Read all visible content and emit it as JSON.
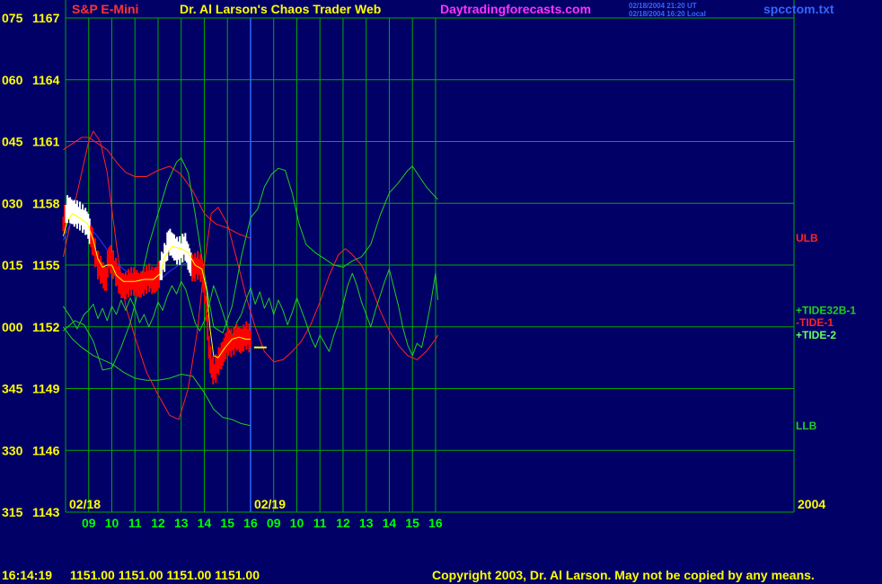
{
  "header": {
    "instrument": "S&P E-Mini",
    "author": "Dr. Al Larson's Chaos Trader Web",
    "site": "Daytradingforecasts.com",
    "stamp_line1": "02/18/2004 21:20 UT",
    "stamp_line2": "02/18/2004 16:20 Local",
    "filename": "spcctom.txt"
  },
  "footer": {
    "time": "16:14:19",
    "quote": "1151.00 1151.00 1151.00 1151.00",
    "copyright": "Copyright 2003, Dr. Al Larson. May not be copied by any means."
  },
  "colors": {
    "background": "#000066",
    "grid": "#00aa00",
    "axis_text": "#ffff00",
    "date_text": "#00ff00",
    "instrument": "#ff3333",
    "site": "#ff33ff",
    "stamp": "#3366ff",
    "filename": "#3366ff",
    "bars_red": "#ff0000",
    "bars_white": "#ffffff",
    "ma_yellow": "#ffff00",
    "ma_blue": "#3333ff",
    "tide_red": "#ff2222",
    "tide_green": "#22cc22",
    "tide_lightgreen": "#66ff66",
    "last_price": "#ffff00"
  },
  "chart_data": {
    "type": "line",
    "y_axis": {
      "ylim": [
        1143,
        1167
      ],
      "ticks": [
        {
          "code": "075",
          "price": "1167",
          "value": 1167
        },
        {
          "code": "060",
          "price": "1164",
          "value": 1164
        },
        {
          "code": "045",
          "price": "1161",
          "value": 1161
        },
        {
          "code": "030",
          "price": "1158",
          "value": 1158
        },
        {
          "code": "015",
          "price": "1155",
          "value": 1155
        },
        {
          "code": "000",
          "price": "1152",
          "value": 1152
        },
        {
          "code": "345",
          "price": "1149",
          "value": 1149
        },
        {
          "code": "330",
          "price": "1146",
          "value": 1146
        },
        {
          "code": "315",
          "price": "1143",
          "value": 1143
        }
      ]
    },
    "x_axis": {
      "xlim": [
        0,
        31.5
      ],
      "hour_ticks": [
        {
          "label": "09",
          "x": 1
        },
        {
          "label": "10",
          "x": 2
        },
        {
          "label": "11",
          "x": 3
        },
        {
          "label": "12",
          "x": 4
        },
        {
          "label": "13",
          "x": 5
        },
        {
          "label": "14",
          "x": 6
        },
        {
          "label": "15",
          "x": 7
        },
        {
          "label": "16",
          "x": 8
        },
        {
          "label": "09",
          "x": 9
        },
        {
          "label": "10",
          "x": 10
        },
        {
          "label": "11",
          "x": 11
        },
        {
          "label": "12",
          "x": 12
        },
        {
          "label": "13",
          "x": 13
        },
        {
          "label": "14",
          "x": 14
        },
        {
          "label": "15",
          "x": 15
        },
        {
          "label": "16",
          "x": 16
        }
      ],
      "date_markers": [
        {
          "label": "02/18",
          "x": 0
        },
        {
          "label": "02/19",
          "x": 8
        }
      ],
      "year_label": "2004",
      "day_divider_x": 8
    },
    "series_labels": [
      {
        "text": "ULB",
        "color": "#ff2222",
        "y": 1156.3
      },
      {
        "text": "+TIDE32B-1",
        "color": "#22cc22",
        "y": 1152.8
      },
      {
        "text": "-TIDE-1",
        "color": "#ff2222",
        "y": 1152.2
      },
      {
        "text": "+TIDE-2",
        "color": "#66ff66",
        "y": 1151.6
      },
      {
        "text": "LLB",
        "color": "#22cc22",
        "y": 1147.2
      }
    ],
    "price": [
      [
        -0.1,
        1157.0
      ],
      [
        0.1,
        1157.8
      ],
      [
        0.25,
        1157.6
      ],
      [
        0.4,
        1157.5
      ],
      [
        0.6,
        1157.4
      ],
      [
        0.8,
        1157.2
      ],
      [
        0.95,
        1157.0
      ],
      [
        1.2,
        1156.0
      ],
      [
        1.4,
        1155.0
      ],
      [
        1.6,
        1154.6
      ],
      [
        1.75,
        1154.2
      ],
      [
        1.85,
        1155.4
      ],
      [
        2.0,
        1155.2
      ],
      [
        2.2,
        1154.6
      ],
      [
        2.4,
        1154.0
      ],
      [
        2.6,
        1154.0
      ],
      [
        2.8,
        1154.2
      ],
      [
        3.0,
        1154.2
      ],
      [
        3.2,
        1154.0
      ],
      [
        3.4,
        1154.2
      ],
      [
        3.6,
        1154.4
      ],
      [
        3.8,
        1154.2
      ],
      [
        4.0,
        1154.4
      ],
      [
        4.2,
        1155.1
      ],
      [
        4.35,
        1155.6
      ],
      [
        4.45,
        1156.2
      ],
      [
        4.6,
        1156.0
      ],
      [
        4.8,
        1155.7
      ],
      [
        5.0,
        1155.7
      ],
      [
        5.15,
        1156.0
      ],
      [
        5.3,
        1155.4
      ],
      [
        5.5,
        1154.8
      ],
      [
        5.7,
        1155.0
      ],
      [
        5.9,
        1154.8
      ],
      [
        6.0,
        1154.0
      ],
      [
        6.1,
        1152.6
      ],
      [
        6.2,
        1151.0
      ],
      [
        6.3,
        1150.0
      ],
      [
        6.45,
        1149.8
      ],
      [
        6.6,
        1150.3
      ],
      [
        6.8,
        1150.7
      ],
      [
        7.0,
        1151.3
      ],
      [
        7.2,
        1151.2
      ],
      [
        7.4,
        1151.5
      ],
      [
        7.6,
        1151.3
      ],
      [
        7.8,
        1151.6
      ],
      [
        8.0,
        1151.4
      ]
    ],
    "white_bar_segments": [
      [
        0.0,
        1.1
      ],
      [
        4.05,
        5.45
      ]
    ],
    "last_price_marker": {
      "x": 8.15,
      "value": 1151.0
    },
    "ma_yellow": [
      [
        -0.1,
        1156.4
      ],
      [
        0.1,
        1157.2
      ],
      [
        0.3,
        1157.5
      ],
      [
        0.6,
        1157.3
      ],
      [
        0.95,
        1157.0
      ],
      [
        1.2,
        1156.2
      ],
      [
        1.4,
        1155.3
      ],
      [
        1.6,
        1154.9
      ],
      [
        1.8,
        1155.0
      ],
      [
        2.0,
        1155.0
      ],
      [
        2.2,
        1154.5
      ],
      [
        2.5,
        1154.2
      ],
      [
        3.0,
        1154.2
      ],
      [
        3.4,
        1154.3
      ],
      [
        3.8,
        1154.3
      ],
      [
        4.1,
        1154.6
      ],
      [
        4.3,
        1155.4
      ],
      [
        4.6,
        1155.9
      ],
      [
        5.0,
        1155.8
      ],
      [
        5.3,
        1155.6
      ],
      [
        5.6,
        1155.0
      ],
      [
        5.9,
        1154.8
      ],
      [
        6.1,
        1153.8
      ],
      [
        6.25,
        1151.9
      ],
      [
        6.4,
        1150.6
      ],
      [
        6.6,
        1150.5
      ],
      [
        6.9,
        1151.0
      ],
      [
        7.2,
        1151.4
      ],
      [
        7.5,
        1151.5
      ],
      [
        7.8,
        1151.4
      ],
      [
        8.0,
        1151.4
      ]
    ],
    "ma_blue": [
      [
        -0.1,
        1156.2
      ],
      [
        0.2,
        1157.0
      ],
      [
        0.5,
        1157.2
      ],
      [
        0.9,
        1156.9
      ],
      [
        1.3,
        1156.5
      ],
      [
        1.7,
        1155.9
      ],
      [
        2.1,
        1155.2
      ],
      [
        2.5,
        1154.8
      ],
      [
        2.9,
        1154.5
      ],
      [
        3.3,
        1154.3
      ],
      [
        3.7,
        1154.2
      ],
      [
        4.1,
        1154.3
      ],
      [
        4.5,
        1154.7
      ],
      [
        4.9,
        1155.0
      ],
      [
        5.3,
        1155.1
      ],
      [
        5.6,
        1155.0
      ],
      [
        5.9,
        1154.6
      ]
    ],
    "ulb": [
      [
        -0.1,
        1160.6
      ],
      [
        0.3,
        1160.9
      ],
      [
        0.7,
        1161.2
      ],
      [
        1.0,
        1161.2
      ],
      [
        1.4,
        1160.9
      ],
      [
        1.8,
        1160.6
      ],
      [
        2.2,
        1160.0
      ],
      [
        2.6,
        1159.5
      ],
      [
        3.0,
        1159.3
      ],
      [
        3.5,
        1159.3
      ],
      [
        4.0,
        1159.6
      ],
      [
        4.5,
        1159.8
      ],
      [
        5.0,
        1159.4
      ],
      [
        5.5,
        1158.6
      ],
      [
        6.0,
        1157.5
      ],
      [
        6.5,
        1157.0
      ],
      [
        7.0,
        1156.8
      ],
      [
        7.5,
        1156.5
      ],
      [
        8.0,
        1156.3
      ]
    ],
    "llb": [
      [
        -0.1,
        1152.0
      ],
      [
        0.3,
        1151.4
      ],
      [
        0.7,
        1151.0
      ],
      [
        1.2,
        1150.6
      ],
      [
        1.6,
        1150.4
      ],
      [
        2.0,
        1150.2
      ],
      [
        2.5,
        1149.8
      ],
      [
        3.0,
        1149.5
      ],
      [
        3.5,
        1149.4
      ],
      [
        4.0,
        1149.4
      ],
      [
        4.5,
        1149.5
      ],
      [
        5.0,
        1149.7
      ],
      [
        5.5,
        1149.6
      ],
      [
        6.0,
        1148.8
      ],
      [
        6.4,
        1148.0
      ],
      [
        6.8,
        1147.6
      ],
      [
        7.2,
        1147.5
      ],
      [
        7.6,
        1147.3
      ],
      [
        8.0,
        1147.2
      ]
    ],
    "tide_red": [
      [
        -0.1,
        1155.4
      ],
      [
        0.3,
        1157.5
      ],
      [
        0.7,
        1159.5
      ],
      [
        1.0,
        1161.0
      ],
      [
        1.2,
        1161.5
      ],
      [
        1.5,
        1161.0
      ],
      [
        1.8,
        1159.5
      ],
      [
        2.2,
        1156.0
      ],
      [
        2.6,
        1153.0
      ],
      [
        3.0,
        1151.5
      ],
      [
        3.5,
        1149.8
      ],
      [
        4.0,
        1148.7
      ],
      [
        4.5,
        1147.7
      ],
      [
        4.9,
        1147.5
      ],
      [
        5.3,
        1149.0
      ],
      [
        5.7,
        1151.8
      ],
      [
        6.0,
        1155.0
      ],
      [
        6.3,
        1157.5
      ],
      [
        6.6,
        1157.8
      ],
      [
        7.0,
        1157.0
      ],
      [
        7.4,
        1155.3
      ],
      [
        7.8,
        1153.5
      ],
      [
        8.2,
        1152.0
      ],
      [
        8.6,
        1150.8
      ],
      [
        9.0,
        1150.3
      ],
      [
        9.4,
        1150.4
      ],
      [
        9.8,
        1150.8
      ],
      [
        10.2,
        1151.3
      ],
      [
        10.6,
        1152.1
      ],
      [
        11.0,
        1153.2
      ],
      [
        11.4,
        1154.5
      ],
      [
        11.8,
        1155.5
      ],
      [
        12.1,
        1155.8
      ],
      [
        12.4,
        1155.5
      ],
      [
        12.8,
        1155.0
      ],
      [
        13.2,
        1154.0
      ],
      [
        13.6,
        1152.8
      ],
      [
        14.0,
        1151.8
      ],
      [
        14.4,
        1151.1
      ],
      [
        14.8,
        1150.6
      ],
      [
        15.2,
        1150.4
      ],
      [
        15.6,
        1150.8
      ],
      [
        16.0,
        1151.4
      ],
      [
        16.1,
        1151.6
      ]
    ],
    "tide_green": [
      [
        -0.1,
        1151.8
      ],
      [
        0.4,
        1152.3
      ],
      [
        0.8,
        1152.1
      ],
      [
        1.2,
        1151.3
      ],
      [
        1.6,
        1149.9
      ],
      [
        2.0,
        1150.0
      ],
      [
        2.4,
        1151.0
      ],
      [
        2.8,
        1152.2
      ],
      [
        3.2,
        1154.0
      ],
      [
        3.6,
        1156.0
      ],
      [
        4.0,
        1157.5
      ],
      [
        4.4,
        1159.0
      ],
      [
        4.8,
        1160.0
      ],
      [
        5.0,
        1160.2
      ],
      [
        5.3,
        1159.5
      ],
      [
        5.6,
        1157.5
      ],
      [
        6.0,
        1154.6
      ],
      [
        6.4,
        1152.0
      ],
      [
        6.8,
        1151.7
      ],
      [
        7.2,
        1153.0
      ],
      [
        7.6,
        1155.4
      ],
      [
        8.0,
        1157.3
      ],
      [
        8.3,
        1157.7
      ],
      [
        8.6,
        1158.8
      ],
      [
        8.9,
        1159.4
      ],
      [
        9.2,
        1159.7
      ],
      [
        9.5,
        1159.6
      ],
      [
        9.8,
        1158.5
      ],
      [
        10.1,
        1157.0
      ],
      [
        10.4,
        1156.0
      ],
      [
        10.8,
        1155.6
      ],
      [
        11.2,
        1155.3
      ],
      [
        11.6,
        1155.0
      ],
      [
        12.0,
        1154.9
      ],
      [
        12.4,
        1155.2
      ],
      [
        12.8,
        1155.4
      ],
      [
        13.2,
        1156.0
      ],
      [
        13.6,
        1157.4
      ],
      [
        14.0,
        1158.5
      ],
      [
        14.4,
        1159.0
      ],
      [
        14.8,
        1159.6
      ],
      [
        15.0,
        1159.8
      ],
      [
        15.3,
        1159.3
      ],
      [
        15.6,
        1158.8
      ],
      [
        16.0,
        1158.3
      ],
      [
        16.1,
        1158.2
      ]
    ],
    "tide_light": [
      [
        -0.1,
        1153.0
      ],
      [
        0.2,
        1152.5
      ],
      [
        0.5,
        1151.9
      ],
      [
        0.8,
        1152.6
      ],
      [
        1.0,
        1152.8
      ],
      [
        1.2,
        1153.1
      ],
      [
        1.4,
        1152.4
      ],
      [
        1.6,
        1152.9
      ],
      [
        1.8,
        1152.3
      ],
      [
        2.0,
        1153.0
      ],
      [
        2.2,
        1152.6
      ],
      [
        2.4,
        1153.3
      ],
      [
        2.6,
        1152.8
      ],
      [
        2.8,
        1153.4
      ],
      [
        3.0,
        1152.9
      ],
      [
        3.2,
        1152.2
      ],
      [
        3.4,
        1152.6
      ],
      [
        3.6,
        1152.0
      ],
      [
        3.8,
        1152.5
      ],
      [
        4.0,
        1153.2
      ],
      [
        4.2,
        1152.8
      ],
      [
        4.4,
        1153.5
      ],
      [
        4.6,
        1154.0
      ],
      [
        4.8,
        1153.6
      ],
      [
        5.0,
        1154.2
      ],
      [
        5.2,
        1153.8
      ],
      [
        5.4,
        1153.0
      ],
      [
        5.6,
        1152.2
      ],
      [
        5.8,
        1151.8
      ],
      [
        6.0,
        1152.3
      ],
      [
        6.2,
        1153.0
      ],
      [
        6.4,
        1154.0
      ],
      [
        6.6,
        1153.4
      ],
      [
        6.8,
        1152.7
      ],
      [
        7.0,
        1152.0
      ],
      [
        7.2,
        1151.5
      ],
      [
        7.4,
        1152.2
      ],
      [
        7.6,
        1152.6
      ],
      [
        7.8,
        1153.3
      ],
      [
        8.0,
        1153.9
      ],
      [
        8.2,
        1153.1
      ],
      [
        8.4,
        1153.7
      ],
      [
        8.6,
        1152.9
      ],
      [
        8.8,
        1153.4
      ],
      [
        9.0,
        1152.6
      ],
      [
        9.2,
        1153.3
      ],
      [
        9.4,
        1152.8
      ],
      [
        9.6,
        1152.1
      ],
      [
        9.8,
        1152.7
      ],
      [
        10.0,
        1153.4
      ],
      [
        10.2,
        1152.8
      ],
      [
        10.4,
        1152.2
      ],
      [
        10.6,
        1151.5
      ],
      [
        10.8,
        1151.0
      ],
      [
        11.0,
        1151.6
      ],
      [
        11.2,
        1151.2
      ],
      [
        11.4,
        1150.8
      ],
      [
        11.6,
        1151.6
      ],
      [
        11.8,
        1152.2
      ],
      [
        12.0,
        1153.1
      ],
      [
        12.2,
        1154.0
      ],
      [
        12.4,
        1154.6
      ],
      [
        12.6,
        1154.0
      ],
      [
        12.8,
        1153.2
      ],
      [
        13.0,
        1152.6
      ],
      [
        13.2,
        1152.0
      ],
      [
        13.4,
        1152.8
      ],
      [
        13.6,
        1153.5
      ],
      [
        13.8,
        1154.2
      ],
      [
        14.0,
        1154.8
      ],
      [
        14.2,
        1153.9
      ],
      [
        14.4,
        1153.0
      ],
      [
        14.6,
        1151.9
      ],
      [
        14.8,
        1151.1
      ],
      [
        15.0,
        1150.6
      ],
      [
        15.2,
        1151.2
      ],
      [
        15.4,
        1151.0
      ],
      [
        15.6,
        1152.0
      ],
      [
        15.8,
        1153.2
      ],
      [
        16.0,
        1154.6
      ],
      [
        16.1,
        1153.3
      ]
    ]
  }
}
